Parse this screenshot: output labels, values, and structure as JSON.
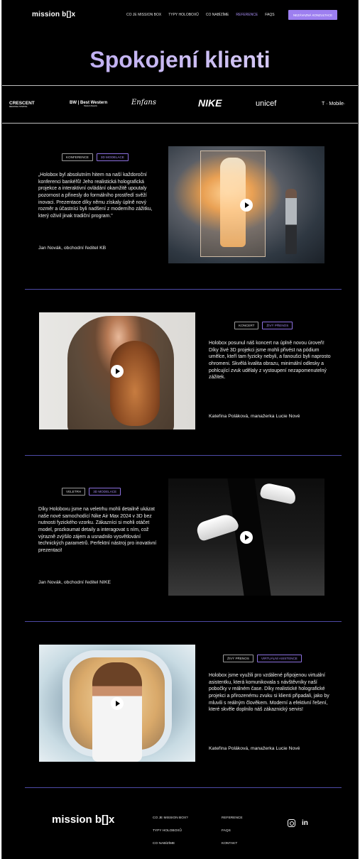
{
  "nav": {
    "logo": "mission b[]x",
    "links": [
      "CO JE MISSION BOX",
      "TYPY HOLOBOXŮ",
      "CO NABÍZÍME",
      "REFERENCE",
      "FAQS"
    ],
    "active_index": 3,
    "cta": "NEZÁVAZNÁ KONZULTACE"
  },
  "hero": {
    "title": "Spokojení klienti"
  },
  "brands": {
    "crescent": "CRESCENT",
    "crescent_sub": "REGIONAL HOSPITAL",
    "bestwestern": "BW | Best Western",
    "bestwestern_sub": "Hotels & Resorts",
    "enfans": "Enfans",
    "nike": "NIKE",
    "unicef": "unicef",
    "tmobile": "T · Mobile·"
  },
  "testimonials": [
    {
      "tags": [
        "KONFERENCE",
        "3D MODELACE"
      ],
      "text": "„Holobox byl absolutním hitem na naší každoroční konferenci bankéřů! Jeho realistická holografická projekce a interaktivní ovládání okamžitě upoutaly pozornost a přinesly do formálního prostředí svěží inovaci. Prezentace díky němu získaly úplně nový rozměr a účastníci byli nadšení z moderního zážitku, který oživil jinak tradiční program.\"",
      "author": "Jan Novák, obchodní ředitel KB"
    },
    {
      "tags": [
        "KONCERT",
        "ŽIVÝ PŘENOS"
      ],
      "text": "Holobox posunul náš koncert na úplně novou úroveň! Díky živé 3D projekci jsme mohli přivést na pódium umělce, kteří tam fyzicky nebyli, a fanoušci byli naprosto ohromeni. Skvělá kvalita obrazu, minimální odlesky a pohlcující zvuk udělaly z vystoupení nezapomenutelný zážitek.",
      "author": "Kateřina Poláková, manažerka Lucie Nové"
    },
    {
      "tags": [
        "VELETRH",
        "3D MODELACE"
      ],
      "text": "Díky Holoboxu jsme na veletrhu mohli detailně ukázat naše nové samochodící Nike Air Max 2024 v 3D bez nutnosti fyzického vzorku. Zákazníci si mohli otáčet model, prozkoumat detaily a interagovat s ním, což výrazně zvýšilo zájem a usnadnilo vysvětlování technických parametrů. Perfektní nástroj pro inovativní prezentaci!",
      "author": "Jan Novák, obchodní ředitel NIKE"
    },
    {
      "tags": [
        "ŽIVÝ PŘENOS",
        "VIRTUÁLNÍ ASISTENCE"
      ],
      "text": "Holobox jsme využili pro vzdálené připojenou virtuální asistentku, která komunikovala s návštěvníky naší pobočky v reálném čase. Díky realistické holografické projekci a přirozenému zvuku si klienti připadali, jako by mluvili s reálným člověkem. Moderní a efektivní řešení, které skvěle doplnilo náš zákaznický servis!",
      "author": "Kateřina Poláková, manažerka Lucie Nové"
    }
  ],
  "footer": {
    "logo": "mission b[]x",
    "col1": [
      "CO JE MISSION BOX?",
      "TYPY HOLOBOXŮ",
      "CO NABÍZÍME"
    ],
    "col2": [
      "REFERENCE",
      "FAQS",
      "KONTAKT"
    ],
    "linkedin": "in"
  },
  "colors": {
    "accent": "#9d7ff0",
    "hero_title": "#c7b8f4",
    "divider": "#4e4aa6",
    "background": "#000000"
  }
}
